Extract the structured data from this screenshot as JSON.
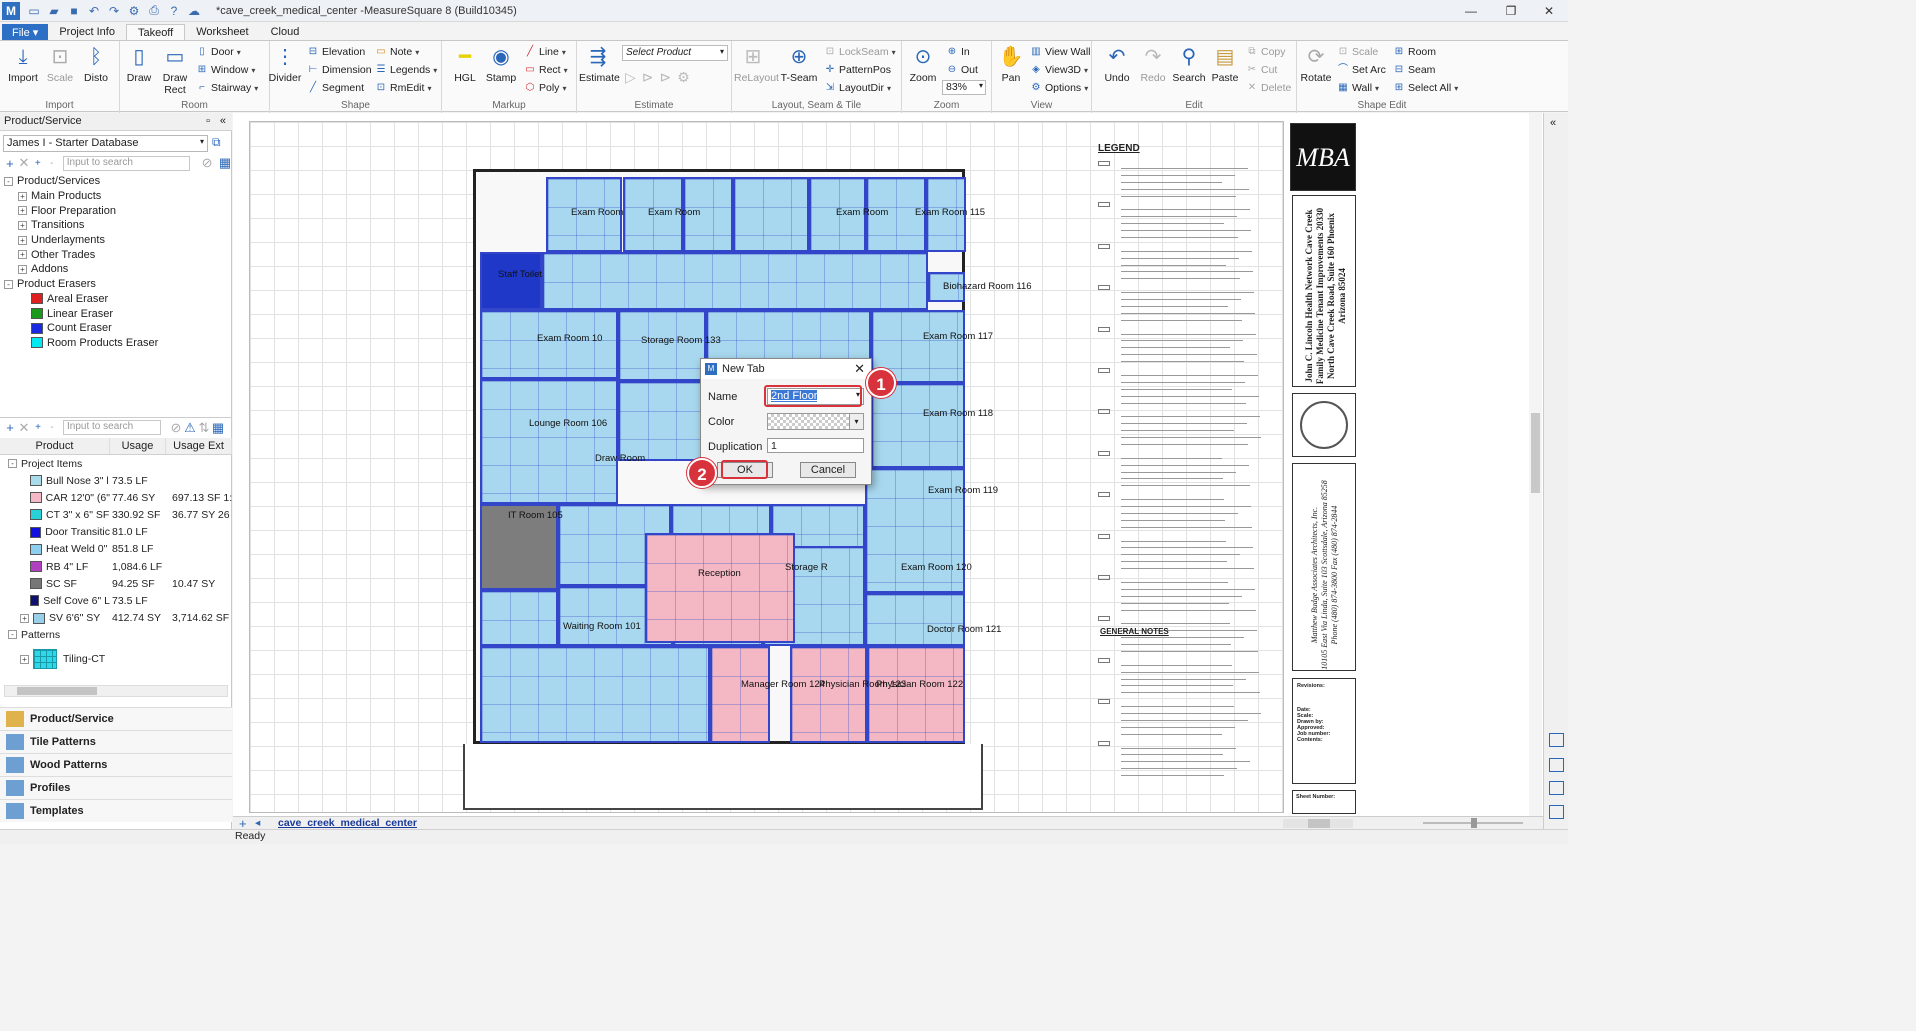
{
  "window": {
    "title": "*cave_creek_medical_center -MeasureSquare 8 (Build10345)"
  },
  "menu": {
    "file_label": "File",
    "tabs": [
      "Project Info",
      "Takeoff",
      "Worksheet",
      "Cloud"
    ],
    "active_tab": "Takeoff"
  },
  "ribbon": {
    "import": {
      "label": "Import",
      "items": [
        "Import",
        "Scale",
        "Disto"
      ]
    },
    "room": {
      "label": "Room",
      "big": [
        "Draw",
        "Draw Rect"
      ],
      "small": [
        "Door",
        "Window",
        "Stairway"
      ]
    },
    "shape": {
      "label": "Shape",
      "big": [
        "Divider"
      ],
      "small": [
        "Elevation",
        "Dimension",
        "Segment",
        "Note",
        "Legends",
        "RmEdit"
      ]
    },
    "markup": {
      "label": "Markup",
      "big": [
        "HGL",
        "Stamp"
      ],
      "small": [
        "Line",
        "Rect",
        "Poly"
      ]
    },
    "estimate": {
      "label": "Estimate",
      "big": [
        "Estimate"
      ],
      "select_placeholder": "Select Product"
    },
    "layout": {
      "label": "Layout, Seam & Tile",
      "big": [
        "ReLayout",
        "T-Seam"
      ],
      "small": [
        "LockSeam",
        "PatternPos",
        "LayoutDir"
      ]
    },
    "zoom": {
      "label": "Zoom",
      "big": [
        "Zoom"
      ],
      "small": [
        "In",
        "Out"
      ],
      "zoom_value": "83%"
    },
    "view": {
      "label": "View",
      "big": [
        "Pan"
      ],
      "small": [
        "View Wall",
        "View3D",
        "Options"
      ]
    },
    "edit": {
      "label": "Edit",
      "big": [
        "Undo",
        "Redo",
        "Search",
        "Paste"
      ],
      "small": [
        "Copy",
        "Cut",
        "Delete"
      ]
    },
    "shape_edit": {
      "label": "Shape Edit",
      "big": [
        "Rotate"
      ],
      "small": [
        "Scale",
        "Set Arc",
        "Wall",
        "Room",
        "Seam",
        "Select All"
      ]
    }
  },
  "left_panel": {
    "header": "Product/Service",
    "database": "James I - Starter Database",
    "search_placeholder": "Input to search",
    "tree": [
      {
        "label": "Product/Services",
        "level": 0,
        "exp": "-"
      },
      {
        "label": "Main Products",
        "level": 1,
        "exp": "+"
      },
      {
        "label": "Floor Preparation",
        "level": 1,
        "exp": "+"
      },
      {
        "label": "Transitions",
        "level": 1,
        "exp": "+"
      },
      {
        "label": "Underlayments",
        "level": 1,
        "exp": "+"
      },
      {
        "label": "Other Trades",
        "level": 1,
        "exp": "+"
      },
      {
        "label": "Addons",
        "level": 1,
        "exp": "+"
      },
      {
        "label": "Product Erasers",
        "level": 0,
        "exp": "-"
      },
      {
        "label": "Areal Eraser",
        "level": 1,
        "color": "#e02020"
      },
      {
        "label": "Linear Eraser",
        "level": 1,
        "color": "#1a9a1a"
      },
      {
        "label": "Count Eraser",
        "level": 1,
        "color": "#1a2ae0"
      },
      {
        "label": "Room Products Eraser",
        "level": 1,
        "color": "#00e8f0"
      }
    ],
    "grid_headers": [
      "Product",
      "Usage",
      "Usage Ext"
    ],
    "project_items_label": "Project Items",
    "items": [
      {
        "product": "Bull Nose 3\" l",
        "usage": "73.5 LF",
        "ext": "",
        "color": "#a8dcea"
      },
      {
        "product": "CAR 12'0\" (6\"",
        "usage": "77.46 SY",
        "ext": "697.13 SF 1:",
        "color": "#f5b8c6"
      },
      {
        "product": "CT 3\" x 6\" SF",
        "usage": "330.92 SF",
        "ext": "36.77 SY 26",
        "color": "#28d0d8"
      },
      {
        "product": "Door Transitic",
        "usage": "81.0 LF",
        "ext": "",
        "color": "#1010e0"
      },
      {
        "product": "Heat Weld 0\"",
        "usage": "851.8 LF",
        "ext": "",
        "color": "#8ecff0"
      },
      {
        "product": "RB 4\" LF",
        "usage": "1,084.6 LF",
        "ext": "",
        "color": "#b040c0"
      },
      {
        "product": "SC  SF",
        "usage": "94.25 SF",
        "ext": "10.47 SY",
        "color": "#777777"
      },
      {
        "product": "Self Cove 6\" L",
        "usage": "73.5 LF",
        "ext": "",
        "color": "#101070"
      },
      {
        "product": "SV 6'6\" SY",
        "usage": "412.74 SY",
        "ext": "3,714.62 SF",
        "color": "#98d0ea"
      }
    ],
    "patterns_label": "Patterns",
    "pattern_item": "Tiling-CT",
    "nav": [
      "Product/Service",
      "Tile Patterns",
      "Wood Patterns",
      "Profiles",
      "Templates"
    ]
  },
  "canvas": {
    "room_labels": [
      "Exam Room",
      "Exam Room",
      "Exam Room",
      "Exam Room 115",
      "Biohazard Room 116",
      "Exam Room 10",
      "Storage Room 133",
      "Exam Room 117",
      "Lounge Room 106",
      "Exam Room 118",
      "Draw Room",
      "Exam Room 119",
      "IT Room 105",
      "Reception",
      "Storage R",
      "Exam Room 120",
      "Waiting Room 101",
      "Doctor Room 121",
      "Manager Room 124",
      "Physician Room 123",
      "Physician Room 122",
      "Staff Toilet"
    ],
    "legend_title": "LEGEND",
    "general_notes_title": "GENERAL NOTES",
    "title_block": {
      "firm": "MBA",
      "project": "John C. Lincoln Health Network Cave Creek Family Medicine Tenant Improvements 20330 North Cave Creek Road, Suite 160 Phoenix Arizona 85024",
      "architect": "Matthew Budge Associates Architects, Inc.",
      "address": "10105 East Via Linda, Suite 103 Scottsdale, Arizona 85258",
      "phone": "Phone (480) 874-3800 Fax (480) 874-2844",
      "revisions": "Revisions:",
      "date": "Date:",
      "scale": "Scale:",
      "drawn_by": "Drawn by:",
      "approved": "Approved:",
      "job_number": "Job number:",
      "contents": "Contents:",
      "sheet_number": "Sheet Number:"
    }
  },
  "dialog": {
    "title": "New Tab",
    "name_label": "Name",
    "name_value": "2nd Floor",
    "color_label": "Color",
    "duplication_label": "Duplication",
    "duplication_value": "1",
    "ok": "OK",
    "cancel": "Cancel"
  },
  "callouts": [
    "1",
    "2"
  ],
  "sheet_tab": "cave_creek_medical_center",
  "status": "Ready",
  "colors": {
    "accent": "#2c6fc4",
    "callout": "#d8323c",
    "room_blue": "#a8d8ef",
    "room_pink": "#f3b8c4",
    "wall": "#3346c9"
  }
}
